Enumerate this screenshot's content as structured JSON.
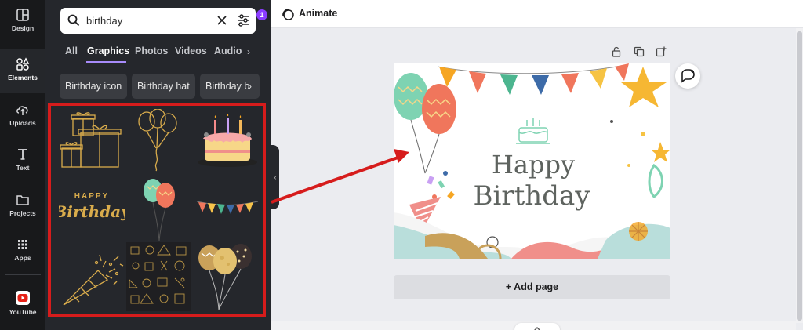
{
  "rail": {
    "items": [
      {
        "label": "Design",
        "icon": "design-icon"
      },
      {
        "label": "Elements",
        "icon": "elements-icon"
      },
      {
        "label": "Uploads",
        "icon": "uploads-icon"
      },
      {
        "label": "Text",
        "icon": "text-icon"
      },
      {
        "label": "Projects",
        "icon": "folder-icon"
      },
      {
        "label": "Apps",
        "icon": "apps-icon"
      },
      {
        "label": "YouTube",
        "icon": "youtube-icon"
      }
    ]
  },
  "search": {
    "value": "birthday",
    "filter_count": "1"
  },
  "tabs": [
    {
      "label": "All"
    },
    {
      "label": "Graphics"
    },
    {
      "label": "Photos"
    },
    {
      "label": "Videos"
    },
    {
      "label": "Audio"
    }
  ],
  "chips": [
    {
      "label": "Birthday icon"
    },
    {
      "label": "Birthday hat"
    },
    {
      "label": "Birthday b"
    }
  ],
  "graphics": [
    {
      "name": "gift-boxes"
    },
    {
      "name": "balloons-outline"
    },
    {
      "name": "birthday-cake"
    },
    {
      "name": "happy-birthday-text",
      "line1": "HAPPY",
      "line2": "Birthday"
    },
    {
      "name": "color-balloons"
    },
    {
      "name": "bunting-flags"
    },
    {
      "name": "party-popper"
    },
    {
      "name": "party-pattern"
    },
    {
      "name": "gold-balloons"
    }
  ],
  "topbar": {
    "animate_label": "Animate"
  },
  "card": {
    "line1": "Happy",
    "line2": "Birthday"
  },
  "add_page_label": "+ Add page",
  "colors": {
    "accent": "#8b3dff",
    "highlight": "#d61c1c",
    "rail": "#18191b",
    "panel": "#25272c"
  }
}
